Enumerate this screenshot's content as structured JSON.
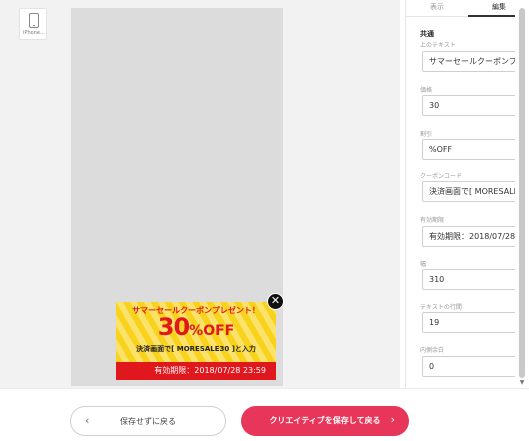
{
  "device": {
    "label": "iPhone…",
    "icon": "phone-icon"
  },
  "coupon": {
    "headline": "サマーセールクーポンプレゼント！",
    "discount_number": "30",
    "discount_suffix": "%OFF",
    "code_text": "決済画面で[ MORESALE30 ]と入力",
    "expiry_text": "有効期限：2018/07/28 23:59",
    "colors": {
      "background": "#f9d21c",
      "accent": "#e0171d"
    }
  },
  "panel": {
    "tabs": [
      {
        "label": "表示",
        "active": false
      },
      {
        "label": "編集",
        "active": true
      }
    ],
    "section_title": "共通",
    "fields": [
      {
        "label": "上のテキスト",
        "value": "サマーセールクーポンプ"
      },
      {
        "label": "価格",
        "value": "30"
      },
      {
        "label": "割引",
        "value": "%OFF"
      },
      {
        "label": "クーポンコード",
        "value": "決済画面で[ MORESALE"
      },
      {
        "label": "有効期限",
        "value": "有効期限：2018/07/28"
      },
      {
        "label": "幅",
        "value": "310"
      },
      {
        "label": "テキストの行間",
        "value": "19"
      },
      {
        "label": "内側余白",
        "value": "0"
      }
    ]
  },
  "footer": {
    "back_label": "保存せずに戻る",
    "save_label": "クリエイティブを保存して戻る",
    "save_color": "#e8365a"
  }
}
